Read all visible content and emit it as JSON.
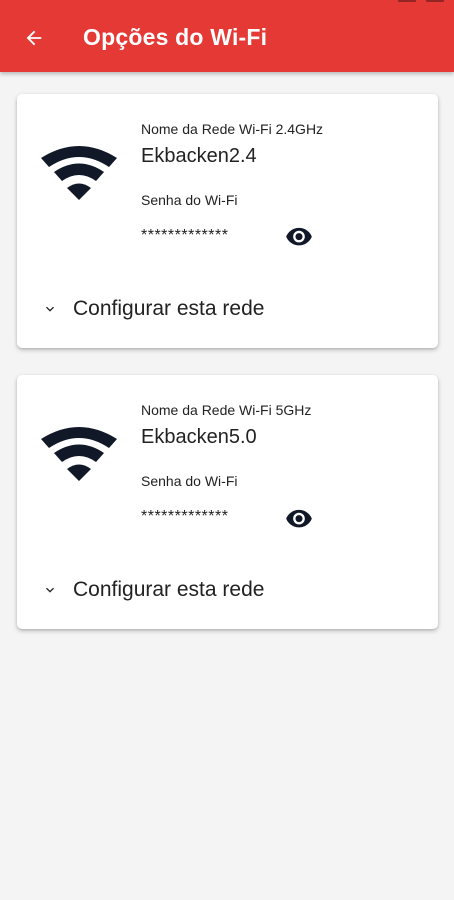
{
  "appbar": {
    "title": "Opções do Wi-Fi",
    "color": "#e53935"
  },
  "networks": [
    {
      "name_label": "Nome da Rede Wi-Fi 2.4GHz",
      "name": "Ekbacken2.4",
      "password_label": "Senha do Wi-Fi",
      "password": "*************",
      "configure_label": "Configurar esta rede"
    },
    {
      "name_label": "Nome da Rede Wi-Fi 5GHz",
      "name": "Ekbacken5.0",
      "password_label": "Senha do Wi-Fi",
      "password": "*************",
      "configure_label": "Configurar esta rede"
    }
  ],
  "icons": {
    "back": "arrow-back-icon",
    "wifi": "wifi-icon",
    "show_password": "eye-icon",
    "expand": "chevron-down-icon"
  }
}
